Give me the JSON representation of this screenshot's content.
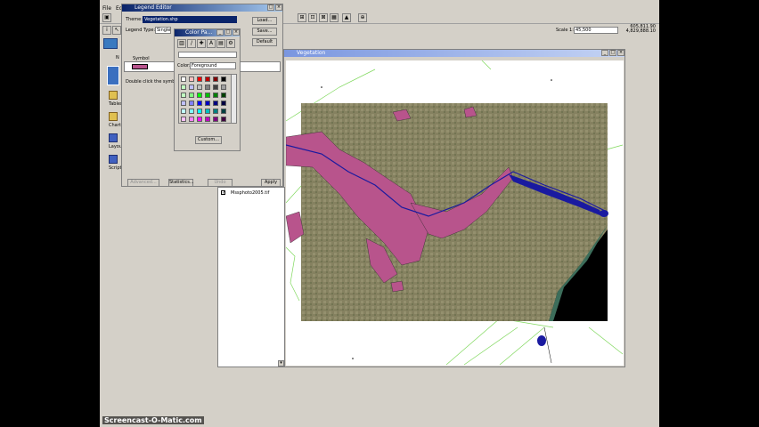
{
  "menubar": {
    "file": "File",
    "edit": "Ec"
  },
  "scale": {
    "label": "Scale 1:",
    "value": "45,500"
  },
  "coords": {
    "x": "605,811.90",
    "y": "4,829,888.10"
  },
  "legend_editor": {
    "title": "Legend Editor",
    "theme_label": "Theme:",
    "theme_value": "Vegetation.shp",
    "legend_type_label": "Legend Type:",
    "legend_type_value": "Single",
    "symbol_header": "Symbol",
    "hint": "Double click the symb",
    "load": "Load...",
    "save": "Save...",
    "default": "Default",
    "advanced": "Advanced...",
    "statistics": "Statistics...",
    "undo": "Undo",
    "apply": "Apply"
  },
  "color_palette": {
    "title": "Color Pa...",
    "color_label": "Color:",
    "color_value": "Foreground",
    "custom": "Custom..."
  },
  "left_panel": {
    "views": "Views",
    "tables": "Tables",
    "charts": "Charts",
    "layouts": "Layouts",
    "scripts": "Scripts",
    "n": "N"
  },
  "map_window": {
    "title": "Vegetation"
  },
  "toc": {
    "layer": "Mssphoto2005.tif"
  },
  "watermark": "Screencast-O-Matic.com",
  "colors": {
    "polygon_fill": "#b8548c",
    "river": "#1a1aa0",
    "title_active": "#0a246a"
  },
  "palette_colors": [
    [
      "#ffffff",
      "#ffc0c0",
      "#ff0000",
      "#c00000",
      "#800000",
      "#000000"
    ],
    [
      "#c0ffc0",
      "#c0c0ff",
      "#c0c0c0",
      "#808080",
      "#404040",
      "#a0a0a0"
    ],
    [
      "#c0ffc0",
      "#80ff80",
      "#00ff00",
      "#00c000",
      "#008000",
      "#004000"
    ],
    [
      "#c0c0ff",
      "#8080ff",
      "#0000ff",
      "#0000c0",
      "#000080",
      "#000040"
    ],
    [
      "#c0ffff",
      "#80ffff",
      "#00ffff",
      "#00c0c0",
      "#008080",
      "#004040"
    ],
    [
      "#ffc0ff",
      "#ff80ff",
      "#ff00ff",
      "#c000c0",
      "#800080",
      "#400040"
    ]
  ]
}
